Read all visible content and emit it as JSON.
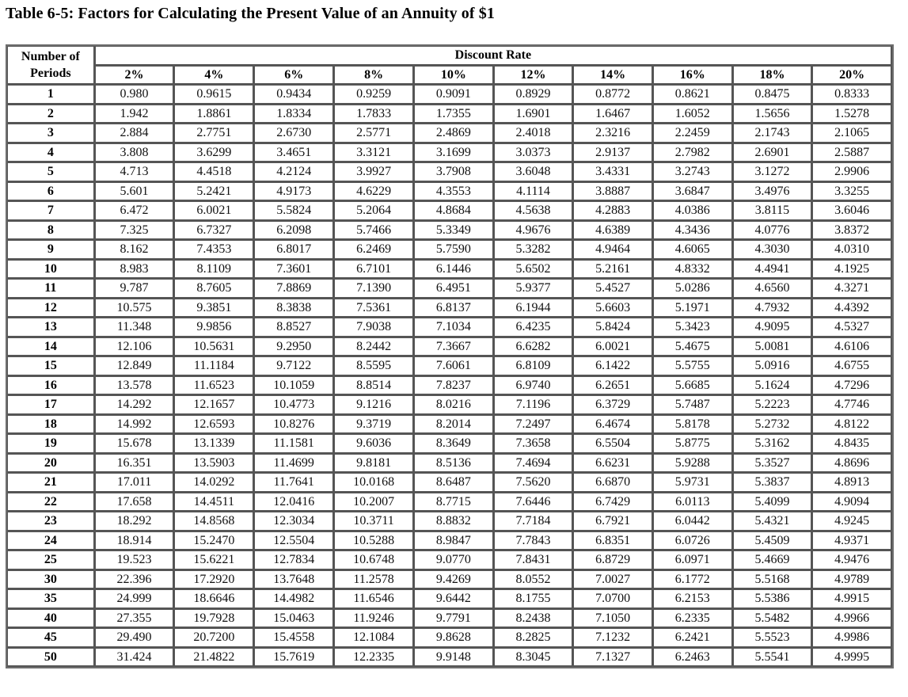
{
  "title": "Table 6-5: Factors for Calculating the Present Value of an Annuity of $1",
  "table": {
    "period_header_line1": "Number of",
    "period_header_line2": "Periods",
    "group_header": "Discount Rate",
    "rates": [
      "2%",
      "4%",
      "6%",
      "8%",
      "10%",
      "12%",
      "14%",
      "16%",
      "18%",
      "20%"
    ],
    "rows": [
      {
        "period": "1",
        "values": [
          "0.980",
          "0.9615",
          "0.9434",
          "0.9259",
          "0.9091",
          "0.8929",
          "0.8772",
          "0.8621",
          "0.8475",
          "0.8333"
        ]
      },
      {
        "period": "2",
        "values": [
          "1.942",
          "1.8861",
          "1.8334",
          "1.7833",
          "1.7355",
          "1.6901",
          "1.6467",
          "1.6052",
          "1.5656",
          "1.5278"
        ]
      },
      {
        "period": "3",
        "values": [
          "2.884",
          "2.7751",
          "2.6730",
          "2.5771",
          "2.4869",
          "2.4018",
          "2.3216",
          "2.2459",
          "2.1743",
          "2.1065"
        ]
      },
      {
        "period": "4",
        "values": [
          "3.808",
          "3.6299",
          "3.4651",
          "3.3121",
          "3.1699",
          "3.0373",
          "2.9137",
          "2.7982",
          "2.6901",
          "2.5887"
        ]
      },
      {
        "period": "5",
        "values": [
          "4.713",
          "4.4518",
          "4.2124",
          "3.9927",
          "3.7908",
          "3.6048",
          "3.4331",
          "3.2743",
          "3.1272",
          "2.9906"
        ]
      },
      {
        "period": "6",
        "values": [
          "5.601",
          "5.2421",
          "4.9173",
          "4.6229",
          "4.3553",
          "4.1114",
          "3.8887",
          "3.6847",
          "3.4976",
          "3.3255"
        ]
      },
      {
        "period": "7",
        "values": [
          "6.472",
          "6.0021",
          "5.5824",
          "5.2064",
          "4.8684",
          "4.5638",
          "4.2883",
          "4.0386",
          "3.8115",
          "3.6046"
        ]
      },
      {
        "period": "8",
        "values": [
          "7.325",
          "6.7327",
          "6.2098",
          "5.7466",
          "5.3349",
          "4.9676",
          "4.6389",
          "4.3436",
          "4.0776",
          "3.8372"
        ]
      },
      {
        "period": "9",
        "values": [
          "8.162",
          "7.4353",
          "6.8017",
          "6.2469",
          "5.7590",
          "5.3282",
          "4.9464",
          "4.6065",
          "4.3030",
          "4.0310"
        ]
      },
      {
        "period": "10",
        "values": [
          "8.983",
          "8.1109",
          "7.3601",
          "6.7101",
          "6.1446",
          "5.6502",
          "5.2161",
          "4.8332",
          "4.4941",
          "4.1925"
        ]
      },
      {
        "period": "11",
        "values": [
          "9.787",
          "8.7605",
          "7.8869",
          "7.1390",
          "6.4951",
          "5.9377",
          "5.4527",
          "5.0286",
          "4.6560",
          "4.3271"
        ]
      },
      {
        "period": "12",
        "values": [
          "10.575",
          "9.3851",
          "8.3838",
          "7.5361",
          "6.8137",
          "6.1944",
          "5.6603",
          "5.1971",
          "4.7932",
          "4.4392"
        ]
      },
      {
        "period": "13",
        "values": [
          "11.348",
          "9.9856",
          "8.8527",
          "7.9038",
          "7.1034",
          "6.4235",
          "5.8424",
          "5.3423",
          "4.9095",
          "4.5327"
        ]
      },
      {
        "period": "14",
        "values": [
          "12.106",
          "10.5631",
          "9.2950",
          "8.2442",
          "7.3667",
          "6.6282",
          "6.0021",
          "5.4675",
          "5.0081",
          "4.6106"
        ]
      },
      {
        "period": "15",
        "values": [
          "12.849",
          "11.1184",
          "9.7122",
          "8.5595",
          "7.6061",
          "6.8109",
          "6.1422",
          "5.5755",
          "5.0916",
          "4.6755"
        ]
      },
      {
        "period": "16",
        "values": [
          "13.578",
          "11.6523",
          "10.1059",
          "8.8514",
          "7.8237",
          "6.9740",
          "6.2651",
          "5.6685",
          "5.1624",
          "4.7296"
        ]
      },
      {
        "period": "17",
        "values": [
          "14.292",
          "12.1657",
          "10.4773",
          "9.1216",
          "8.0216",
          "7.1196",
          "6.3729",
          "5.7487",
          "5.2223",
          "4.7746"
        ]
      },
      {
        "period": "18",
        "values": [
          "14.992",
          "12.6593",
          "10.8276",
          "9.3719",
          "8.2014",
          "7.2497",
          "6.4674",
          "5.8178",
          "5.2732",
          "4.8122"
        ]
      },
      {
        "period": "19",
        "values": [
          "15.678",
          "13.1339",
          "11.1581",
          "9.6036",
          "8.3649",
          "7.3658",
          "6.5504",
          "5.8775",
          "5.3162",
          "4.8435"
        ]
      },
      {
        "period": "20",
        "values": [
          "16.351",
          "13.5903",
          "11.4699",
          "9.8181",
          "8.5136",
          "7.4694",
          "6.6231",
          "5.9288",
          "5.3527",
          "4.8696"
        ]
      },
      {
        "period": "21",
        "values": [
          "17.011",
          "14.0292",
          "11.7641",
          "10.0168",
          "8.6487",
          "7.5620",
          "6.6870",
          "5.9731",
          "5.3837",
          "4.8913"
        ]
      },
      {
        "period": "22",
        "values": [
          "17.658",
          "14.4511",
          "12.0416",
          "10.2007",
          "8.7715",
          "7.6446",
          "6.7429",
          "6.0113",
          "5.4099",
          "4.9094"
        ]
      },
      {
        "period": "23",
        "values": [
          "18.292",
          "14.8568",
          "12.3034",
          "10.3711",
          "8.8832",
          "7.7184",
          "6.7921",
          "6.0442",
          "5.4321",
          "4.9245"
        ]
      },
      {
        "period": "24",
        "values": [
          "18.914",
          "15.2470",
          "12.5504",
          "10.5288",
          "8.9847",
          "7.7843",
          "6.8351",
          "6.0726",
          "5.4509",
          "4.9371"
        ]
      },
      {
        "period": "25",
        "values": [
          "19.523",
          "15.6221",
          "12.7834",
          "10.6748",
          "9.0770",
          "7.8431",
          "6.8729",
          "6.0971",
          "5.4669",
          "4.9476"
        ]
      },
      {
        "period": "30",
        "values": [
          "22.396",
          "17.2920",
          "13.7648",
          "11.2578",
          "9.4269",
          "8.0552",
          "7.0027",
          "6.1772",
          "5.5168",
          "4.9789"
        ]
      },
      {
        "period": "35",
        "values": [
          "24.999",
          "18.6646",
          "14.4982",
          "11.6546",
          "9.6442",
          "8.1755",
          "7.0700",
          "6.2153",
          "5.5386",
          "4.9915"
        ]
      },
      {
        "period": "40",
        "values": [
          "27.355",
          "19.7928",
          "15.0463",
          "11.9246",
          "9.7791",
          "8.2438",
          "7.1050",
          "6.2335",
          "5.5482",
          "4.9966"
        ]
      },
      {
        "period": "45",
        "values": [
          "29.490",
          "20.7200",
          "15.4558",
          "12.1084",
          "9.8628",
          "8.2825",
          "7.1232",
          "6.2421",
          "5.5523",
          "4.9986"
        ]
      },
      {
        "period": "50",
        "values": [
          "31.424",
          "21.4822",
          "15.7619",
          "12.2335",
          "9.9148",
          "8.3045",
          "7.1327",
          "6.2463",
          "5.5541",
          "4.9995"
        ]
      }
    ]
  }
}
